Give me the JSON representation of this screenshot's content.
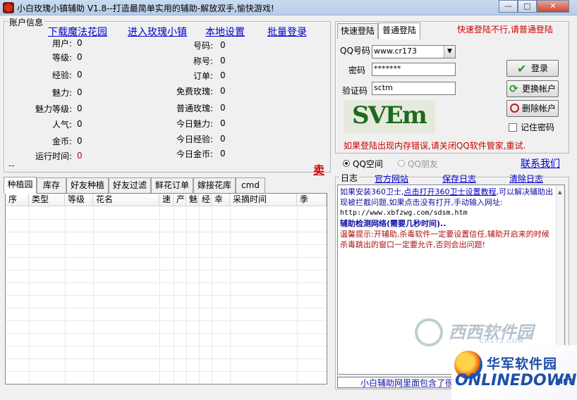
{
  "window": {
    "title": "小白玫瑰小镇辅助 V1.8--打造最简单实用的辅助-解放双手,愉快游戏!",
    "minimize": "—",
    "maximize": "□",
    "close": "✕"
  },
  "account": {
    "legend": "账户信息",
    "links": [
      "下载魔法花园",
      "进入玫瑰小镇",
      "本地设置",
      "批量登录"
    ],
    "left_fields": [
      {
        "label": "用户:",
        "value": "0"
      },
      {
        "label": "等级:",
        "value": "0"
      },
      {
        "label": "经验:",
        "value": "0"
      },
      {
        "label": "魅力:",
        "value": "0"
      },
      {
        "label": "魅力等级:",
        "value": "0"
      },
      {
        "label": "人气:",
        "value": "0"
      },
      {
        "label": "金币:",
        "value": "0"
      },
      {
        "label": "运行时间:",
        "value": "0"
      }
    ],
    "right_fields": [
      {
        "label": "号码:",
        "value": "0"
      },
      {
        "label": "称号:",
        "value": "0"
      },
      {
        "label": "订单:",
        "value": "0"
      },
      {
        "label": "免费玫瑰:",
        "value": "0"
      },
      {
        "label": "普通玫瑰:",
        "value": "0"
      },
      {
        "label": "今日魅力:",
        "value": "0"
      },
      {
        "label": "今日经验:",
        "value": "0"
      },
      {
        "label": "今日金币:",
        "value": "0"
      }
    ],
    "dash": "--",
    "sell": "卖"
  },
  "tabs": [
    "种植园",
    "库存",
    "好友种植",
    "好友过滤",
    "鲜花订单",
    "嫁接花库",
    "cmd"
  ],
  "table": {
    "columns": [
      "序",
      "类型",
      "等级",
      "花名",
      "速",
      "产",
      "魅",
      "经",
      "幸",
      "采摘时间",
      "季"
    ]
  },
  "login": {
    "tabs": [
      "快速登陆",
      "普通登陆"
    ],
    "notice": "快速登陆不行,请普通登陆",
    "qq_label": "QQ号码",
    "qq_value": "www.cr173",
    "password_label": "密码",
    "password_value": "*******",
    "captcha_label": "验证码",
    "captcha_value": "sctm",
    "captcha_image_text": "SVEm",
    "login_button": "登录",
    "switch_button": "更换帐户",
    "delete_button": "删除帐户",
    "remember_label": "记住密码",
    "warning": "如果登陆出现内存错误,请关闭QQ软件管家,重试.",
    "contact": "联系我们",
    "radio_qzone": "QQ空间",
    "radio_friends": "QQ朋友"
  },
  "log": {
    "legend": "日志",
    "links": [
      "官方网站",
      "保存日志",
      "清除日志"
    ],
    "line1_a": "如果安装360卫士,",
    "line1_link": "点击打开360卫士设置教程",
    "line1_b": ",可以解决辅助出现被拦截问题,如果点击没有打开,手动输入网址:",
    "url": "http://www.xbfzwg.com/sdsm.htm",
    "detect": "辅助检测网络(需要几秒时间)..",
    "tip": "温馨提示:开辅助,杀毒软件一定要设置信任,辅助开启来的时候杀毒跳出的窗口一定要允许,否则会出问题!",
    "status": "小白辅助网里面包含了很"
  },
  "watermark": {
    "site1": "西西软件园",
    "site1_url": "CR173.COM",
    "site2_cn": "华军软件园",
    "site2_en": "ONLINEDOWN",
    "site2_net": ".NET"
  }
}
